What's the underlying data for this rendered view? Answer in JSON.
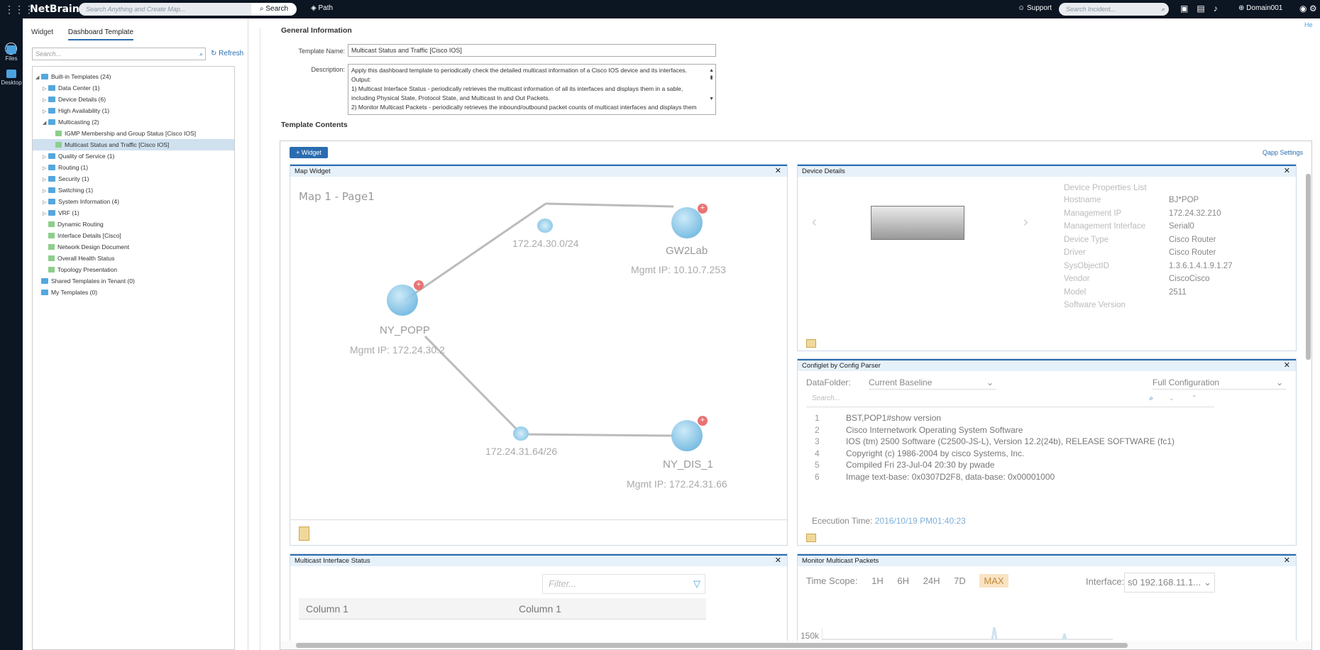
{
  "topbar": {
    "logo": "NetBrain",
    "search_placeholder": "Search Anything and Create Map...",
    "search_button": "Search",
    "path_button": "Path",
    "support": "Support",
    "incident_placeholder": "Search Incident...",
    "domain": "Domain001",
    "help": "He"
  },
  "rail": {
    "files": "Files",
    "desktop": "Desktop"
  },
  "left": {
    "tabs": [
      "Widget",
      "Dashboard Template"
    ],
    "search_placeholder": "Search...",
    "refresh": "Refresh",
    "tree": [
      {
        "label": "Built-in Templates (24)",
        "type": "folder",
        "toggle": "◢",
        "indent": 0
      },
      {
        "label": "Data Center (1)",
        "type": "folder",
        "toggle": "▷",
        "indent": 1
      },
      {
        "label": "Device Details (6)",
        "type": "folder",
        "toggle": "▷",
        "indent": 1
      },
      {
        "label": "High Availability (1)",
        "type": "folder",
        "toggle": "▷",
        "indent": 1
      },
      {
        "label": "Multicasting (2)",
        "type": "folder",
        "toggle": "◢",
        "indent": 1
      },
      {
        "label": "IGMP Membership and Group Status [Cisco IOS]",
        "type": "doc",
        "toggle": "",
        "indent": 2
      },
      {
        "label": "Multicast Status and Traffic [Cisco IOS]",
        "type": "doc",
        "toggle": "",
        "indent": 2,
        "selected": true
      },
      {
        "label": "Quality of Service (1)",
        "type": "folder",
        "toggle": "▷",
        "indent": 1
      },
      {
        "label": "Routing (1)",
        "type": "folder",
        "toggle": "▷",
        "indent": 1
      },
      {
        "label": "Security (1)",
        "type": "folder",
        "toggle": "▷",
        "indent": 1
      },
      {
        "label": "Switching (1)",
        "type": "folder",
        "toggle": "▷",
        "indent": 1
      },
      {
        "label": "System Information (4)",
        "type": "folder",
        "toggle": "▷",
        "indent": 1
      },
      {
        "label": "VRF (1)",
        "type": "folder",
        "toggle": "▷",
        "indent": 1
      },
      {
        "label": "Dynamic Routing",
        "type": "doc",
        "toggle": "",
        "indent": 1
      },
      {
        "label": "Interface Details [Cisco]",
        "type": "doc",
        "toggle": "",
        "indent": 1
      },
      {
        "label": "Network Design Document",
        "type": "doc",
        "toggle": "",
        "indent": 1
      },
      {
        "label": "Overall Health Status",
        "type": "doc",
        "toggle": "",
        "indent": 1
      },
      {
        "label": "Topology Presentation",
        "type": "doc",
        "toggle": "",
        "indent": 1
      },
      {
        "label": "Shared Templates in Tenant (0)",
        "type": "folder",
        "toggle": "",
        "indent": 0
      },
      {
        "label": "My Templates (0)",
        "type": "folder",
        "toggle": "",
        "indent": 0
      }
    ]
  },
  "general": {
    "heading": "General Information",
    "name_label": "Template Name:",
    "name_value": "Multicast Status and Traffic [Cisco IOS]",
    "desc_label": "Description:",
    "desc_lines": [
      "Apply this dashboard template to periodically check the detailed multicast information of a Cisco IOS device and its interfaces.",
      "Output:",
      "1) Multicast Interface Status - periodically retrieves the multicast information of all its interfaces and displays them in a sable,",
      "including Physical State, Protocol State, and Multicast In and Out Packets.",
      "2) Monitor Multicast Packets - periodically retrieves the inbound/outbound packet counts of multicast interfaces and displays them in"
    ]
  },
  "contents": {
    "heading": "Template Contents",
    "add_widget": "Widget",
    "qapp_settings": "Qapp Settings"
  },
  "map_widget": {
    "title": "Map Widget",
    "page": "Map 1 - Page1",
    "nodes": {
      "gw": {
        "name": "GW2Lab",
        "ip": "Mgmt IP:  10.10.7.253"
      },
      "ny": {
        "name": "NY_POPP",
        "ip": "Mgmt IP:  172.24.30.2"
      },
      "dis": {
        "name": "NY_DIS_1",
        "ip": "Mgmt IP:  172.24.31.66"
      }
    },
    "subnets": [
      "172.24.30.0/24",
      "172.24.31.64/26"
    ]
  },
  "device_details": {
    "title": "Device Details",
    "list_title": "Device Properties List",
    "props": [
      {
        "k": "Hostname",
        "v": "BJ*POP"
      },
      {
        "k": "Management IP",
        "v": "172.24.32.210"
      },
      {
        "k": "Management Interface",
        "v": "Serial0"
      },
      {
        "k": "Device Type",
        "v": "Cisco Router"
      },
      {
        "k": "Driver",
        "v": "Cisco Router"
      },
      {
        "k": "SysObjectID",
        "v": "1.3.6.1.4.1.9.1.27"
      },
      {
        "k": "Vendor",
        "v": "CiscoCisco"
      },
      {
        "k": "Model",
        "v": "2511"
      },
      {
        "k": "Software Version",
        "v": ""
      }
    ]
  },
  "configlet": {
    "title": "Configlet by Config Parser",
    "folder_label": "DataFolder:",
    "folder_value": "Current Baseline",
    "view_value": "Full Configuration",
    "search_placeholder": "Search...",
    "lines": [
      {
        "n": "1",
        "t": "BST,POP1#show version"
      },
      {
        "n": "2",
        "t": "Cisco Internetwork Operating System Software"
      },
      {
        "n": "3",
        "t": "IOS (tm) 2500 Software (C2500-JS-L), Version 12.2(24b), RELEASE SOFTWARE (fc1)"
      },
      {
        "n": "4",
        "t": "Copyright (c) 1986-2004 by cisco Systems, Inc."
      },
      {
        "n": "5",
        "t": "Compiled Fri 23-Jul-04 20:30 by pwade"
      },
      {
        "n": "6",
        "t": "Image text-base: 0x0307D2F8, data-base: 0x00001000"
      }
    ],
    "exec_label": "Ececution Time:",
    "exec_value": "2016/10/19 PM01:40:23"
  },
  "mis": {
    "title": "Multicast Interface Status",
    "filter_placeholder": "Filter...",
    "columns": [
      "Column 1",
      "Column 1"
    ]
  },
  "mmp": {
    "title": "Monitor Multicast Packets",
    "scope_label": "Time Scope:",
    "scopes": [
      "1H",
      "6H",
      "24H",
      "7D",
      "MAX"
    ],
    "iface_label": "Interface:",
    "iface_value": "s0 192.168.11.1...",
    "ytick": "150k"
  }
}
